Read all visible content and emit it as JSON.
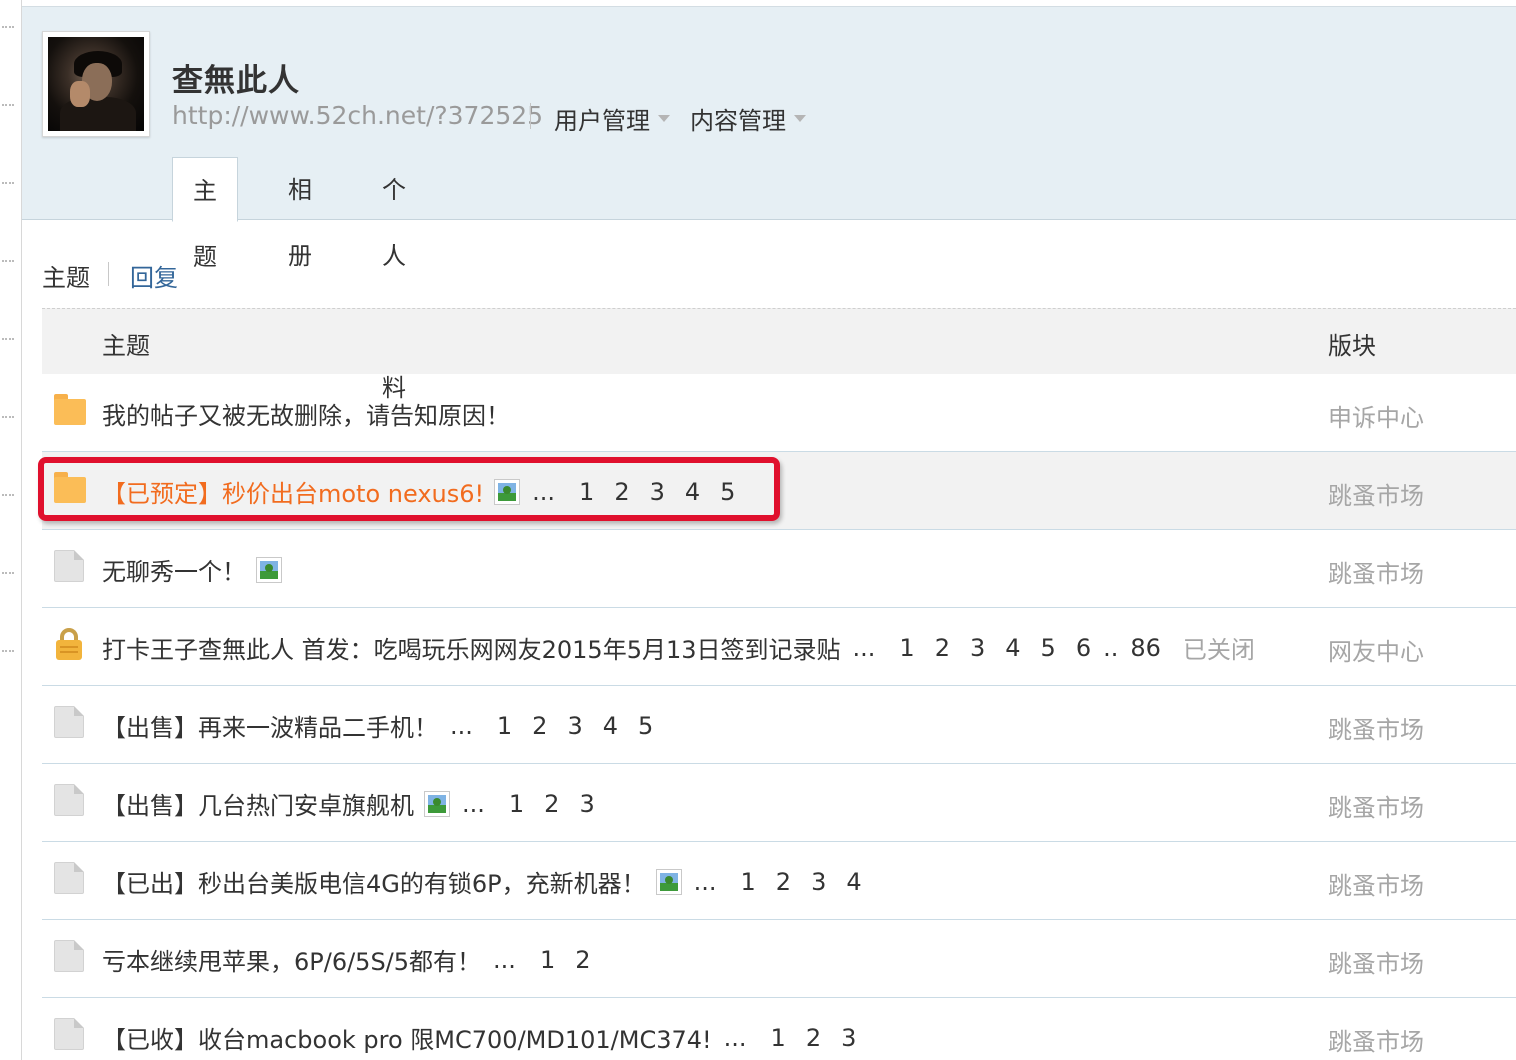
{
  "profile": {
    "name": "查無此人",
    "url": "http://www.52ch.net/?372525",
    "menus": [
      "用户管理",
      "内容管理"
    ]
  },
  "tabs": [
    "主题",
    "相册",
    "个人资料"
  ],
  "subtabs": {
    "active": "主题",
    "other": "回复"
  },
  "table": {
    "headers": {
      "topic": "主题",
      "forum": "版块"
    },
    "rows": [
      {
        "icon": "folder-new-icon",
        "title": "我的帖子又被无故删除，请告知原因！",
        "has_image": false,
        "pages": [],
        "ellipsis": "",
        "forum": "申诉中心",
        "highlight": false
      },
      {
        "icon": "folder-new-icon",
        "title": "【已预定】秒价出台moto nexus6!",
        "has_image": true,
        "ellipsis": "...",
        "pages": [
          "1",
          "2",
          "3",
          "4",
          "5"
        ],
        "forum": "跳蚤市场",
        "highlight": true
      },
      {
        "icon": "page-icon",
        "title": "无聊秀一个！",
        "has_image": true,
        "ellipsis": "",
        "pages": [],
        "forum": "跳蚤市场",
        "highlight": false
      },
      {
        "icon": "lock-icon",
        "title": "打卡王子查無此人 首发：吃喝玩乐网网友2015年5月13日签到记录贴",
        "has_image": false,
        "ellipsis": "...",
        "pages": [
          "1",
          "2",
          "3",
          "4",
          "5",
          "6",
          "..",
          "86"
        ],
        "status": "已关闭",
        "forum": "网友中心",
        "highlight": false
      },
      {
        "icon": "page-icon",
        "title": "【出售】再来一波精品二手机！",
        "has_image": false,
        "ellipsis": "...",
        "pages": [
          "1",
          "2",
          "3",
          "4",
          "5"
        ],
        "forum": "跳蚤市场",
        "highlight": false
      },
      {
        "icon": "page-icon",
        "title": "【出售】几台热门安卓旗舰机",
        "has_image": true,
        "ellipsis": "...",
        "pages": [
          "1",
          "2",
          "3"
        ],
        "forum": "跳蚤市场",
        "highlight": false
      },
      {
        "icon": "page-icon",
        "title": "【已出】秒出台美版电信4G的有锁6P，充新机器！",
        "has_image": true,
        "ellipsis": "...",
        "pages": [
          "1",
          "2",
          "3",
          "4"
        ],
        "forum": "跳蚤市场",
        "highlight": false
      },
      {
        "icon": "page-icon",
        "title": "亏本继续甩苹果，6P/6/5S/5都有！",
        "has_image": false,
        "ellipsis": "...",
        "pages": [
          "1",
          "2"
        ],
        "forum": "跳蚤市场",
        "highlight": false
      },
      {
        "icon": "page-icon",
        "title": "【已收】收台macbook pro 限MC700/MD101/MC374!",
        "has_image": false,
        "ellipsis": "...",
        "pages": [
          "1",
          "2",
          "3"
        ],
        "forum": "跳蚤市场",
        "highlight": false
      }
    ]
  },
  "colors": {
    "accent_link": "#336699",
    "highlight_title": "#f26c1f",
    "annotation_red": "#e0102d",
    "header_bg": "#e6eff4"
  }
}
